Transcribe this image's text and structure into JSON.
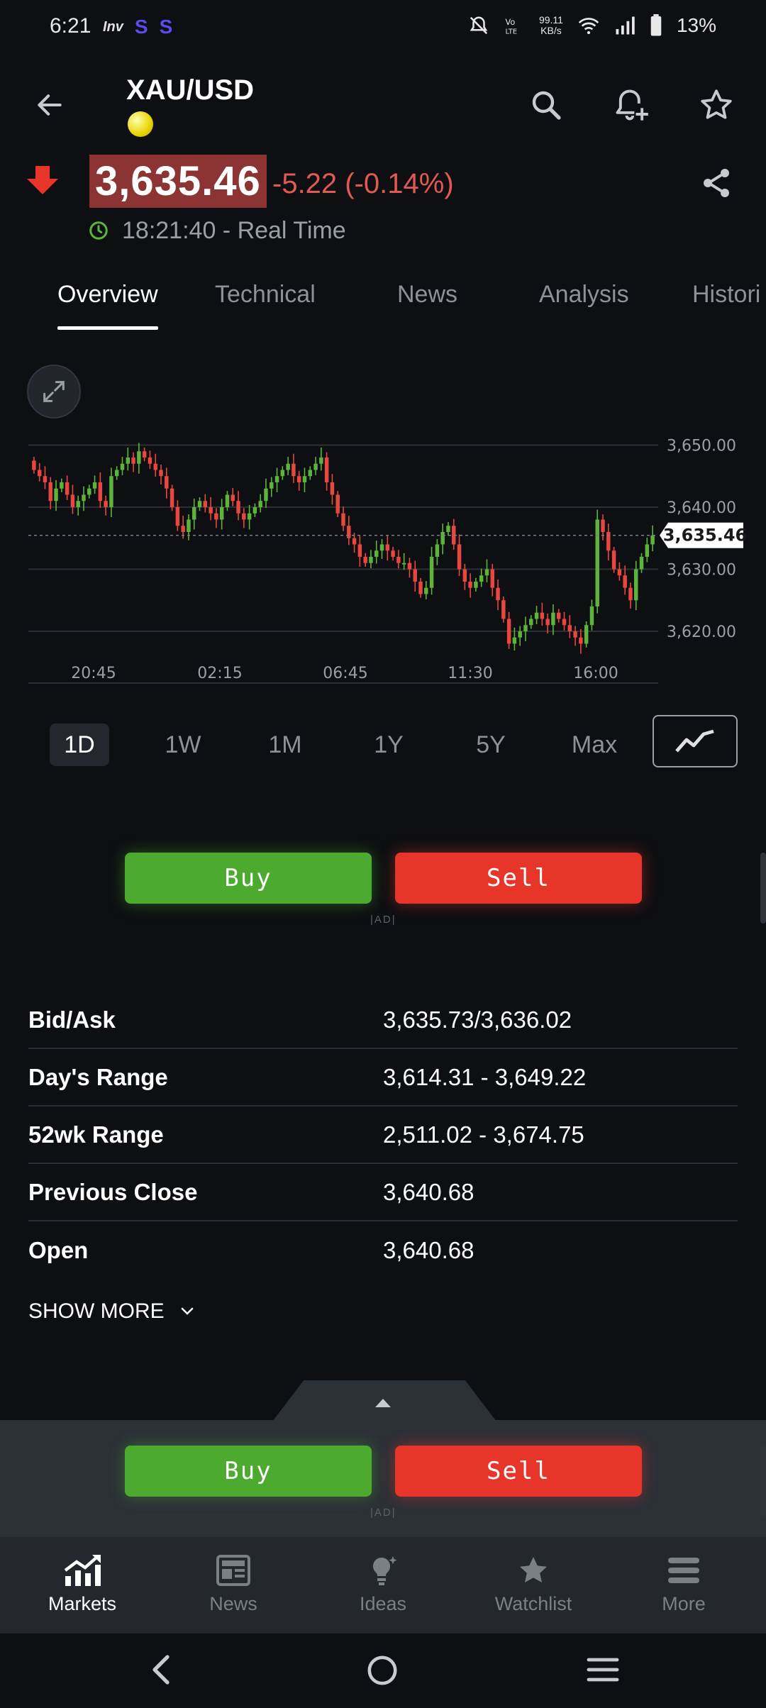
{
  "status_bar": {
    "time": "6:21",
    "inv_label": "Inv",
    "s1": "S",
    "s2": "S",
    "net_speed_value": "99.11",
    "net_speed_unit": "KB/s",
    "battery": "13%"
  },
  "header": {
    "symbol": "XAU/USD"
  },
  "quote": {
    "price": "3,635.46",
    "change": "-5.22 (-0.14%)",
    "time": "18:21:40 - Real Time",
    "down_color": "#e05a52"
  },
  "tabs": [
    {
      "label": "Overview"
    },
    {
      "label": "Technical"
    },
    {
      "label": "News"
    },
    {
      "label": "Analysis"
    },
    {
      "label": "Histori"
    }
  ],
  "chart_data": {
    "type": "candlestick",
    "y_ticks": [
      "3,650.00",
      "3,640.00",
      "3,630.00",
      "3,620.00"
    ],
    "y_tick_values": [
      3650,
      3640,
      3630,
      3620
    ],
    "ylim": [
      3612,
      3654
    ],
    "x_ticks": [
      "20:45",
      "02:15",
      "06:45",
      "11:30",
      "16:00"
    ],
    "current_price_label": "3,635.46",
    "current_price": 3635.46,
    "up_color": "#5cb53a",
    "down_color": "#e8473f",
    "closes": [
      3646,
      3645,
      3644,
      3641,
      3643,
      3644,
      3642,
      3640,
      3641,
      3642,
      3643,
      3644,
      3641,
      3640,
      3645,
      3646,
      3647,
      3648,
      3647,
      3649,
      3648,
      3647,
      3646,
      3645,
      3643,
      3640,
      3637,
      3636,
      3638,
      3640,
      3641,
      3640,
      3639,
      3638,
      3640,
      3642,
      3641,
      3639,
      3638,
      3639,
      3640,
      3641,
      3643,
      3644,
      3645,
      3646,
      3647,
      3645,
      3644,
      3645,
      3646,
      3647,
      3648,
      3644,
      3642,
      3639,
      3637,
      3635,
      3634,
      3632,
      3631,
      3632,
      3633,
      3634,
      3633,
      3632,
      3631,
      3631,
      3630,
      3628,
      3626,
      3627,
      3632,
      3634,
      3636,
      3637,
      3634,
      3630,
      3628,
      3627,
      3628,
      3629,
      3630,
      3627,
      3625,
      3622,
      3618,
      3619,
      3620,
      3621,
      3622,
      3623,
      3622,
      3621,
      3623,
      3622,
      3621,
      3620,
      3619,
      3618,
      3621,
      3624,
      3638,
      3636,
      3633,
      3630,
      3629,
      3627,
      3625,
      3630,
      3632,
      3634,
      3635.46
    ]
  },
  "timeframes": [
    {
      "label": "1D"
    },
    {
      "label": "1W"
    },
    {
      "label": "1M"
    },
    {
      "label": "1Y"
    },
    {
      "label": "5Y"
    },
    {
      "label": "Max"
    }
  ],
  "trade": {
    "buy_label": "Buy",
    "sell_label": "Sell",
    "ad_label": "|AD|"
  },
  "stats": [
    {
      "label": "Bid/Ask",
      "value": "3,635.73/3,636.02"
    },
    {
      "label": "Day's Range",
      "value": "3,614.31 - 3,649.22"
    },
    {
      "label": "52wk Range",
      "value": "2,511.02 - 3,674.75"
    },
    {
      "label": "Previous Close",
      "value": "3,640.68"
    },
    {
      "label": "Open",
      "value": "3,640.68"
    }
  ],
  "show_more_label": "SHOW MORE",
  "bottom_nav": [
    {
      "label": "Markets",
      "icon": "markets-icon"
    },
    {
      "label": "News",
      "icon": "news-icon"
    },
    {
      "label": "Ideas",
      "icon": "ideas-icon"
    },
    {
      "label": "Watchlist",
      "icon": "watchlist-icon"
    },
    {
      "label": "More",
      "icon": "menu-icon"
    }
  ]
}
